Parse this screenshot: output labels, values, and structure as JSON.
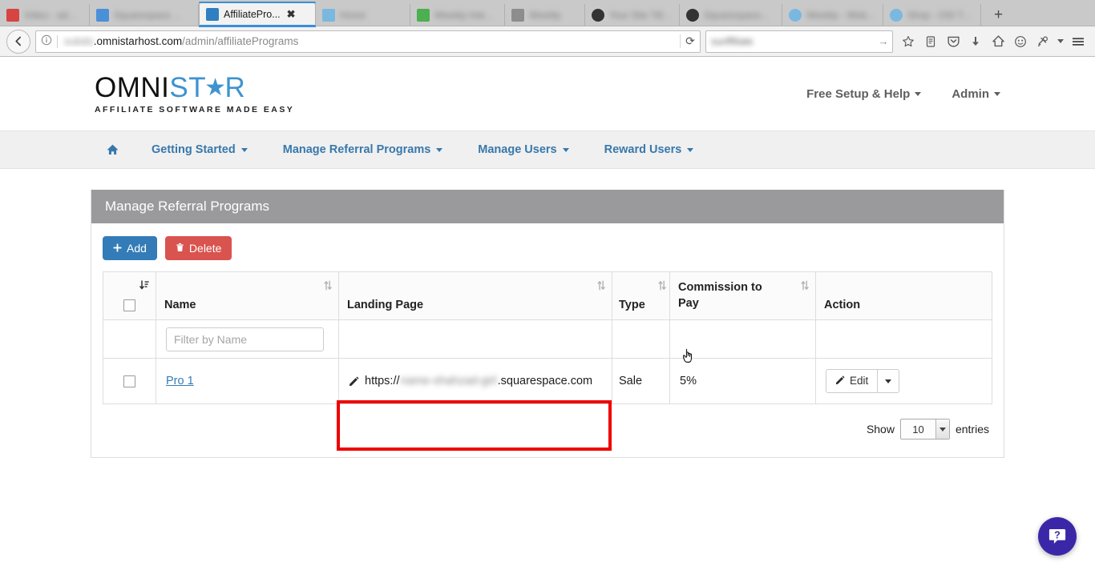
{
  "browser": {
    "tabs": [
      {
        "label": "Video - admi...",
        "active": false,
        "blurred": true,
        "favicon": "#d64541"
      },
      {
        "label": "Squarespace ...",
        "active": false,
        "blurred": true,
        "favicon": "#4a90d9"
      },
      {
        "label": "AffiliatePro...",
        "active": true,
        "blurred": false,
        "favicon": "#2f7fc1",
        "close": "✖"
      },
      {
        "label": "Home",
        "active": false,
        "blurred": true,
        "favicon": "#7ab8e0"
      },
      {
        "label": "Weebly Integ...",
        "active": false,
        "blurred": true,
        "favicon": "#4caf50"
      },
      {
        "label": "Weebly",
        "active": false,
        "blurred": true,
        "favicon": "#8d8d8d"
      },
      {
        "label": "Your Site Title...",
        "active": false,
        "blurred": true,
        "favicon": "#333333"
      },
      {
        "label": "Squarespace...",
        "active": false,
        "blurred": true,
        "favicon": "#333333"
      },
      {
        "label": "Weebly - Web...",
        "active": false,
        "blurred": true,
        "favicon": "#7ab8e0"
      },
      {
        "label": "Shop - OSI Test",
        "active": false,
        "blurred": true,
        "favicon": "#7ab8e0"
      }
    ],
    "new_tab_label": "+",
    "url": {
      "blurred_prefix": "subdo",
      "host": ".omnistarhost.com",
      "path": "/admin/affiliatePrograms"
    },
    "search_query": "sunffiliate",
    "reload_label": "⟳",
    "back_label": "←",
    "toolbar_icons": [
      "bookmark-star-icon",
      "reader-icon",
      "pocket-icon",
      "downloads-icon",
      "home-icon",
      "account-icon",
      "addons-icon",
      "overflow-caret-icon",
      "menu-icon"
    ]
  },
  "header": {
    "logo": {
      "part1": "OMNI",
      "part2": "ST",
      "part3": "R",
      "tagline": "AFFILIATE SOFTWARE MADE EASY"
    },
    "links": [
      {
        "label": "Free Setup & Help"
      },
      {
        "label": "Admin"
      }
    ]
  },
  "mainnav": {
    "home_label": "",
    "items": [
      {
        "label": "Getting Started",
        "caret": true
      },
      {
        "label": "Manage Referral Programs",
        "caret": true
      },
      {
        "label": "Manage Users",
        "caret": true
      },
      {
        "label": "Reward Users",
        "caret": true
      }
    ]
  },
  "panel": {
    "title": "Manage Referral Programs",
    "buttons": {
      "add": "Add",
      "delete": "Delete"
    }
  },
  "table": {
    "columns": [
      {
        "key": "check",
        "label": ""
      },
      {
        "key": "name",
        "label": "Name"
      },
      {
        "key": "landing",
        "label": "Landing Page"
      },
      {
        "key": "type",
        "label": "Type"
      },
      {
        "key": "commission",
        "label": "Commission to Pay"
      },
      {
        "key": "action",
        "label": "Action"
      }
    ],
    "filter_placeholder": "Filter by Name",
    "rows": [
      {
        "name": "Pro 1",
        "landing_prefix": "https://",
        "landing_blurred": "name-shahzad-girl",
        "landing_suffix": ".squarespace.com",
        "type": "Sale",
        "commission": "5%",
        "action_label": "Edit"
      }
    ]
  },
  "footer": {
    "show_label": "Show",
    "entries_value": "10",
    "entries_label": "entries"
  },
  "chat": {
    "glyph": "?"
  },
  "colors": {
    "brand_blue": "#3e93d0",
    "nav_link": "#3778ac",
    "panel_header": "#9a999c",
    "add_button": "#337cb7",
    "delete_button": "#d9534f",
    "annotation_red": "#ef0000",
    "chat_purple": "#3a27a8"
  }
}
